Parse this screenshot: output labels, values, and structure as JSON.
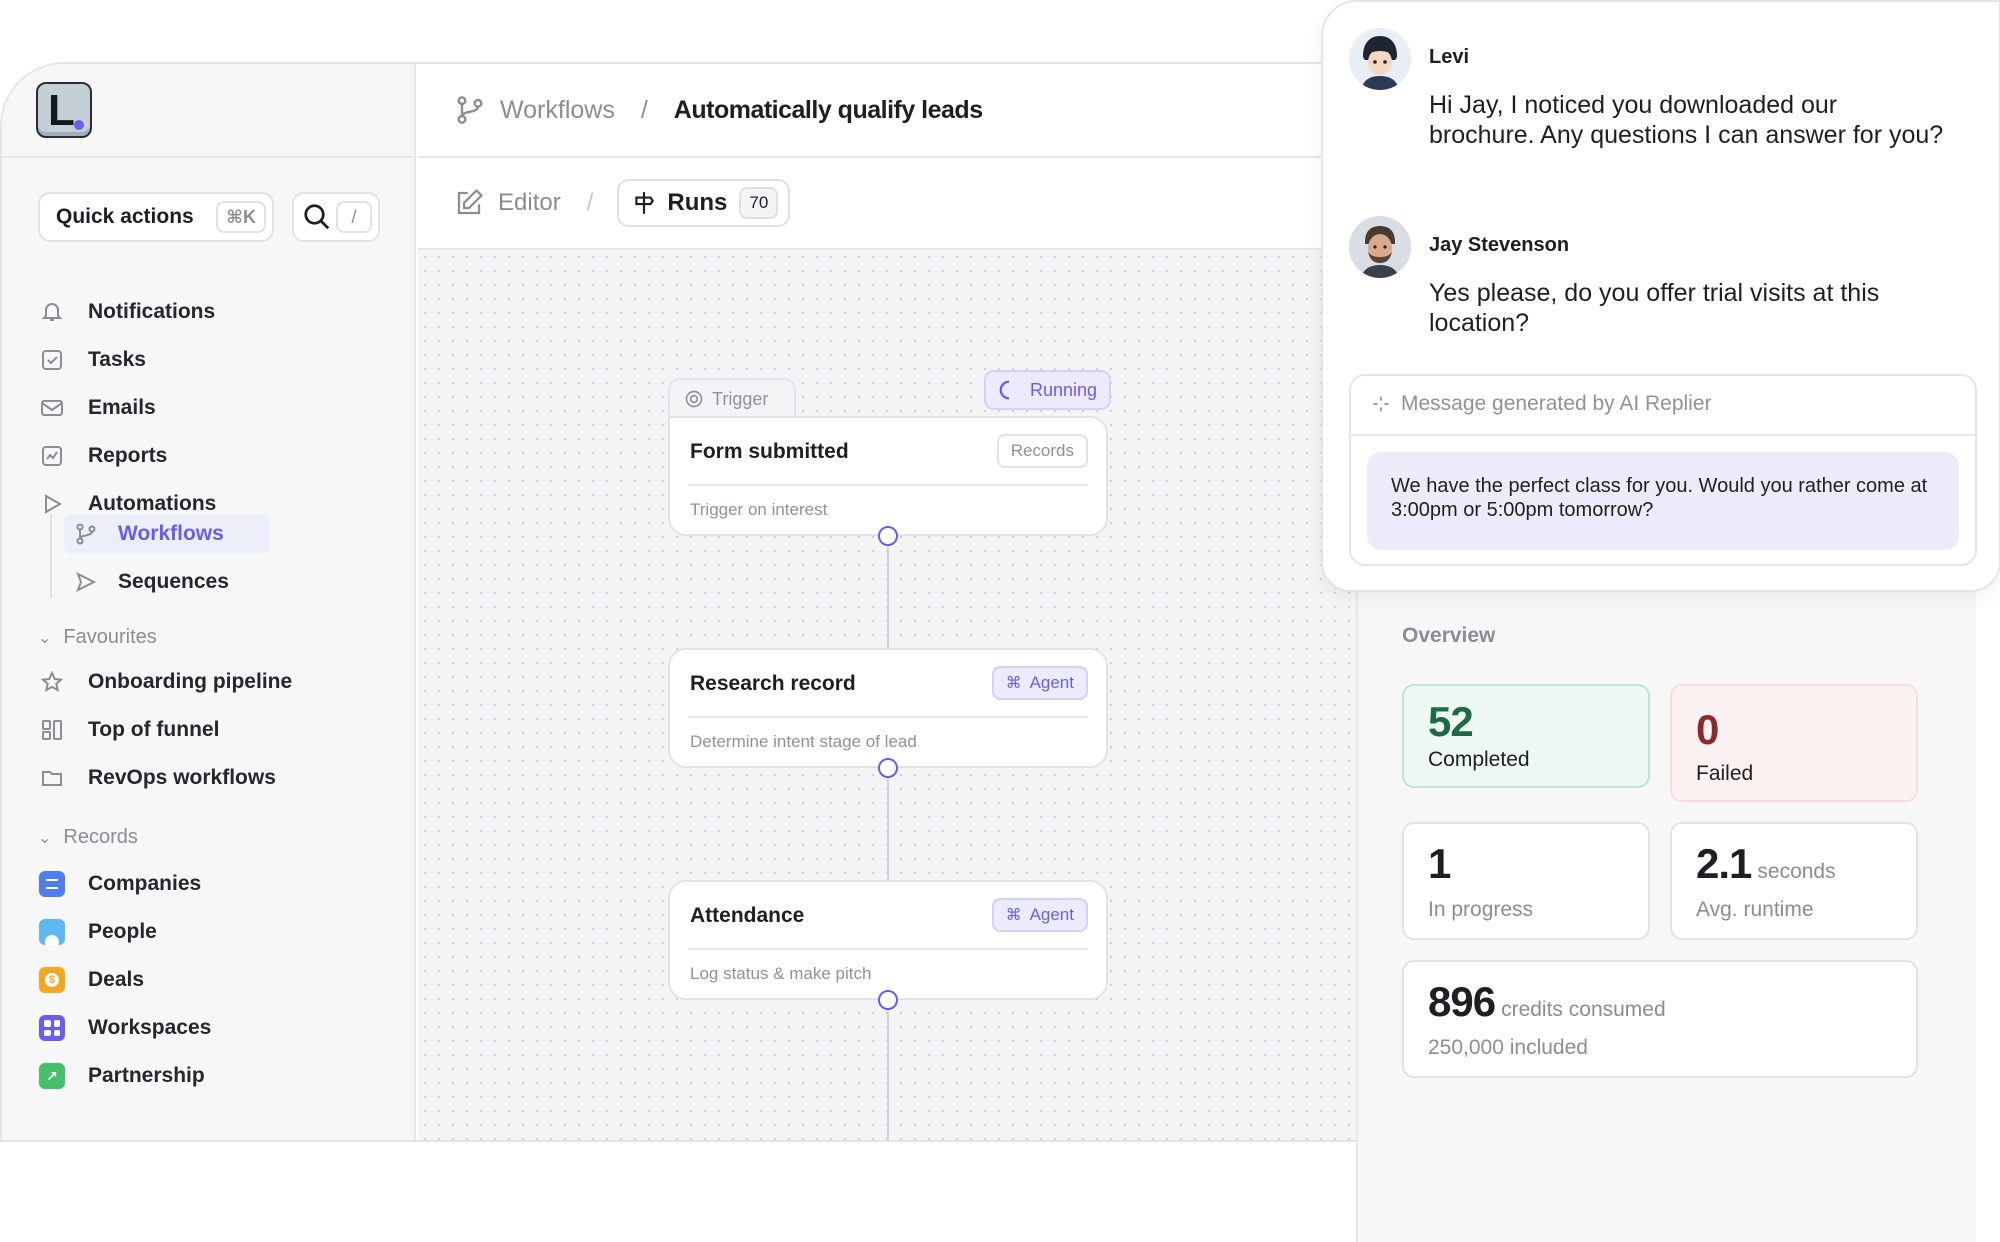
{
  "sidebar": {
    "logo_letter": "L",
    "quick_actions": {
      "label": "Quick actions",
      "shortcut": "⌘K"
    },
    "search_shortcut": "/",
    "items": [
      {
        "label": "Notifications",
        "icon": "bell-icon"
      },
      {
        "label": "Tasks",
        "icon": "checkbox-icon"
      },
      {
        "label": "Emails",
        "icon": "mail-icon"
      },
      {
        "label": "Reports",
        "icon": "chart-icon"
      },
      {
        "label": "Automations",
        "icon": "play-icon"
      },
      {
        "label": "Workflows",
        "icon": "branch-icon"
      },
      {
        "label": "Sequences",
        "icon": "send-icon"
      }
    ],
    "favourites_label": "Favourites",
    "favourites": [
      {
        "label": "Onboarding pipeline",
        "icon": "star-icon"
      },
      {
        "label": "Top of funnel",
        "icon": "kanban-icon"
      },
      {
        "label": "RevOps workflows",
        "icon": "folder-icon"
      }
    ],
    "records_label": "Records",
    "records": [
      {
        "label": "Companies",
        "color": "#4f7cf0"
      },
      {
        "label": "People",
        "color": "#5bb8f0"
      },
      {
        "label": "Deals",
        "color": "#f5a623"
      },
      {
        "label": "Workspaces",
        "color": "#6a5cf0"
      },
      {
        "label": "Partnership",
        "color": "#44c06a"
      }
    ]
  },
  "header": {
    "breadcrumb_parent": "Workflows",
    "breadcrumb_sep": "/",
    "breadcrumb_current": "Automatically qualify leads"
  },
  "subbar": {
    "editor_label": "Editor",
    "sep": "/",
    "runs_label": "Runs",
    "runs_count": "70"
  },
  "canvas": {
    "trigger_tab": "Trigger",
    "running_label": "Running",
    "nodes": [
      {
        "title": "Form submitted",
        "badge": "Records",
        "desc": "Trigger on interest"
      },
      {
        "title": "Research record",
        "badge": "Agent",
        "desc": "Determine intent stage of lead"
      },
      {
        "title": "Attendance",
        "badge": "Agent",
        "desc": "Log status & make pitch"
      }
    ]
  },
  "overview": {
    "title": "Overview",
    "completed": {
      "value": "52",
      "label": "Completed"
    },
    "failed": {
      "value": "0",
      "label": "Failed"
    },
    "in_progress": {
      "value": "1",
      "label": "In progress"
    },
    "runtime": {
      "value": "2.1",
      "unit": "seconds",
      "label": "Avg. runtime"
    },
    "credits": {
      "value": "896",
      "unit": "credits consumed",
      "label": "250,000 included"
    }
  },
  "chat": {
    "messages": [
      {
        "name": "Levi",
        "text": "Hi Jay, I noticed you downloaded our brochure. Any questions I can answer for you?"
      },
      {
        "name": "Jay Stevenson",
        "text": "Yes please, do you offer trial visits at this location?"
      }
    ],
    "ai_label": "Message generated by AI Replier",
    "ai_message": "We have the perfect class for you. Would you rather come at 3:00pm or 5:00pm tomorrow?"
  },
  "colors": {
    "accent": "#6a5cf0",
    "completed_bg": "#eef8f2",
    "failed_bg": "#fdf1f1"
  }
}
